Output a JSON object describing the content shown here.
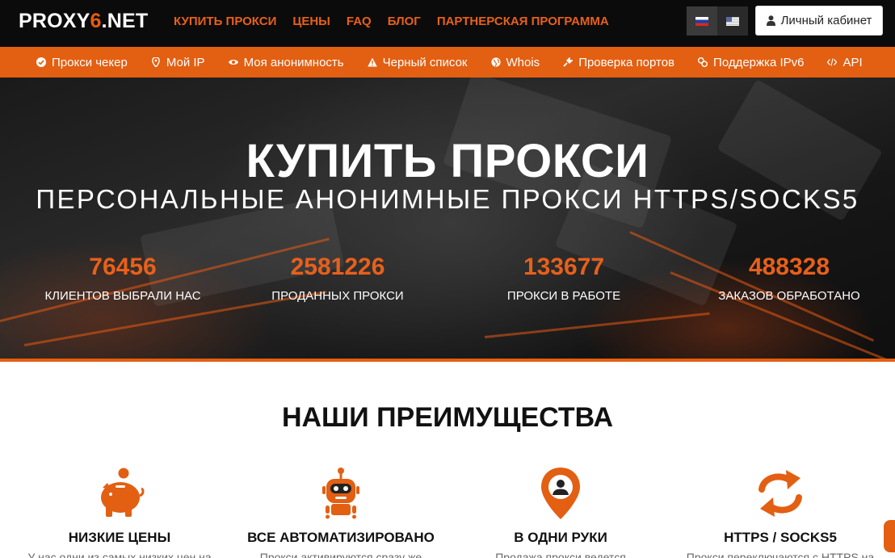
{
  "header": {
    "logo_prefix": "PROXY",
    "logo_digit": "6",
    "logo_suffix": ".NET",
    "nav": [
      "КУПИТЬ ПРОКСИ",
      "ЦЕНЫ",
      "FAQ",
      "БЛОГ",
      "ПАРТНЕРСКАЯ ПРОГРАММА"
    ],
    "cabinet_label": "Личный кабинет"
  },
  "tools": [
    {
      "label": "Прокси чекер",
      "icon": "check-circle-icon"
    },
    {
      "label": "Мой IP",
      "icon": "map-pin-icon"
    },
    {
      "label": "Моя анонимность",
      "icon": "eye-icon"
    },
    {
      "label": "Черный список",
      "icon": "warning-icon"
    },
    {
      "label": "Whois",
      "icon": "globe-icon"
    },
    {
      "label": "Проверка портов",
      "icon": "plug-icon"
    },
    {
      "label": "Поддержка IPv6",
      "icon": "link-icon"
    },
    {
      "label": "API",
      "icon": "code-icon"
    }
  ],
  "hero": {
    "title": "КУПИТЬ ПРОКСИ",
    "subtitle": "ПЕРСОНАЛЬНЫЕ АНОНИМНЫЕ ПРОКСИ HTTPS/SOCKS5",
    "stats": [
      {
        "value": "76456",
        "label": "КЛИЕНТОВ ВЫБРАЛИ НАС"
      },
      {
        "value": "2581226",
        "label": "ПРОДАННЫХ ПРОКСИ"
      },
      {
        "value": "133677",
        "label": "ПРОКСИ В РАБОТЕ"
      },
      {
        "value": "488328",
        "label": "ЗАКАЗОВ ОБРАБОТАНО"
      }
    ]
  },
  "advantages": {
    "title": "НАШИ ПРЕИМУЩЕСТВА",
    "items": [
      {
        "name": "НИЗКИЕ ЦЕНЫ",
        "desc": "У нас одни из самых низких цен на",
        "icon": "piggy-bank-icon"
      },
      {
        "name": "ВСЕ АВТОМАТИЗИРОВАНО",
        "desc": "Прокси активируются сразу же",
        "icon": "robot-icon"
      },
      {
        "name": "В ОДНИ РУКИ",
        "desc": "Продажа прокси ведется",
        "icon": "person-pin-icon"
      },
      {
        "name": "HTTPS / SOCKS5",
        "desc": "Прокси переключаются с HTTPS на",
        "icon": "refresh-arrows-icon"
      }
    ]
  },
  "colors": {
    "accent": "#e35f12",
    "dark": "#0b0b0b"
  }
}
